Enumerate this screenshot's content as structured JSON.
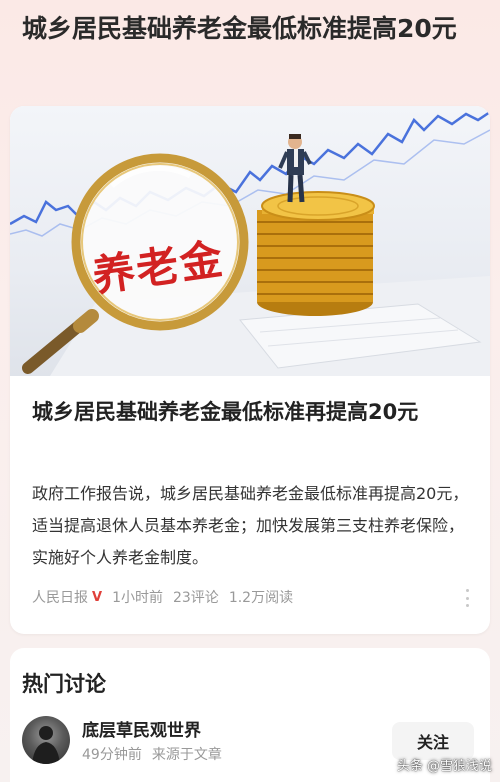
{
  "page": {
    "title": "城乡居民基础养老金最低标准提高20元"
  },
  "article": {
    "image_text": "养老金",
    "title": "城乡居民基础养老金最低标准再提高20元",
    "summary": "政府工作报告说，城乡居民基础养老金最低标准再提高20元，适当提高退休人员基本养老金；加快发展第三支柱养老保险，实施好个人养老金制度。",
    "source": "人民日报",
    "verified_mark": "V",
    "time": "1小时前",
    "comments": "23评论",
    "reads": "1.2万阅读"
  },
  "discussion": {
    "title": "热门讨论",
    "author": "底层草民观世界",
    "time": "49分钟前",
    "source": "来源于文章",
    "follow_label": "关注"
  },
  "watermark": "头条 @雪狼浅说",
  "colors": {
    "accent_red": "#d22222",
    "verified_red": "#e0403a",
    "chart_blue": "#3d66d8",
    "coin_gold": "#e0a82a"
  },
  "icons": [
    "more-dots-icon",
    "magnifier-icon",
    "coin-stack-icon",
    "businessman-icon",
    "stock-chart-icon"
  ]
}
